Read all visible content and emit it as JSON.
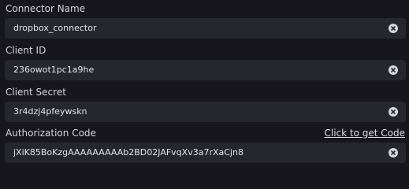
{
  "fields": [
    {
      "label": "Connector Name",
      "value": "dropbox_connector"
    },
    {
      "label": "Client ID",
      "value": "236owot1pc1a9he"
    },
    {
      "label": "Client Secret",
      "value": "3r4dzj4pfeywskn"
    },
    {
      "label": "Authorization Code",
      "value": "jXiK85BoKzgAAAAAAAAAb2BD02JAFvqXv3a7rXaCjn8",
      "link": "Click to get Code"
    }
  ]
}
